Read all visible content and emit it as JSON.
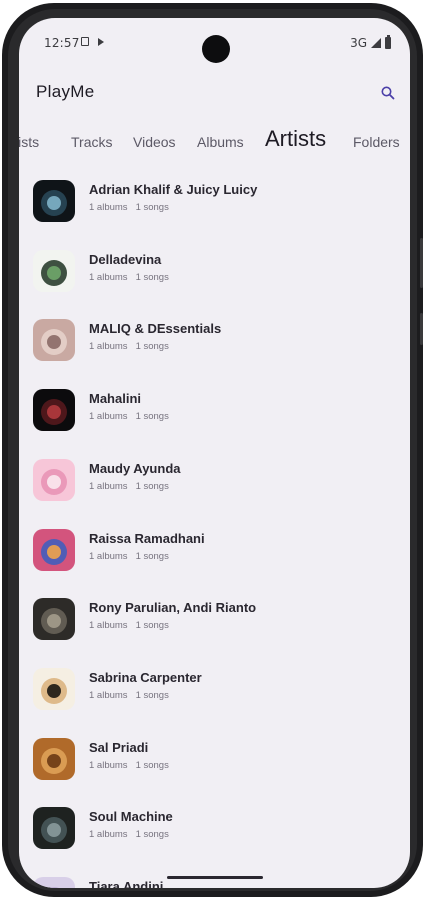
{
  "status_bar": {
    "time": "12:57",
    "network": "3G",
    "icons": [
      "photo-icon",
      "play-icon",
      "signal-icon",
      "battery-icon"
    ]
  },
  "app": {
    "title": "PlayMe",
    "search_icon": "search-icon"
  },
  "tabs": [
    {
      "label": "lists",
      "active": false
    },
    {
      "label": "Tracks",
      "active": false
    },
    {
      "label": "Videos",
      "active": false
    },
    {
      "label": "Albums",
      "active": false
    },
    {
      "label": "Artists",
      "active": true
    },
    {
      "label": "Folders",
      "active": false
    }
  ],
  "artists": [
    {
      "name": "Adrian Khalif & Juicy Luicy",
      "albums": "1 albums",
      "songs": "1 songs",
      "art_colors": [
        "#0f1418",
        "#2a4a5c",
        "#7fb3c8"
      ]
    },
    {
      "name": "Delladevina",
      "albums": "1 albums",
      "songs": "1 songs",
      "art_colors": [
        "#f2f4f0",
        "#1f3322",
        "#6fa66a"
      ]
    },
    {
      "name": "MALIQ & DEssentials",
      "albums": "1 albums",
      "songs": "1 songs",
      "art_colors": [
        "#c9a9a2",
        "#e8d4cc",
        "#8a6a66"
      ]
    },
    {
      "name": "Mahalini",
      "albums": "1 albums",
      "songs": "1 songs",
      "art_colors": [
        "#0c0b0d",
        "#5a1a1e",
        "#b23a3e"
      ]
    },
    {
      "name": "Maudy Ayunda",
      "albums": "1 albums",
      "songs": "1 songs",
      "art_colors": [
        "#f7c6d8",
        "#e890b4",
        "#fbe9ef"
      ]
    },
    {
      "name": "Raissa Ramadhani",
      "albums": "1 albums",
      "songs": "1 songs",
      "art_colors": [
        "#d3547d",
        "#3a5fbf",
        "#f0a34a"
      ]
    },
    {
      "name": "Rony Parulian, Andi Rianto",
      "albums": "1 albums",
      "songs": "1 songs",
      "art_colors": [
        "#2d2b28",
        "#6b655a",
        "#a49c8c"
      ]
    },
    {
      "name": "Sabrina Carpenter",
      "albums": "1 albums",
      "songs": "1 songs",
      "art_colors": [
        "#f5efe3",
        "#d9b07a",
        "#1a1712"
      ]
    },
    {
      "name": "Sal Priadi",
      "albums": "1 albums",
      "songs": "1 songs",
      "art_colors": [
        "#b06a2a",
        "#e2a55a",
        "#6a3a14"
      ]
    },
    {
      "name": "Soul Machine",
      "albums": "1 albums",
      "songs": "1 songs",
      "art_colors": [
        "#1e2220",
        "#4a5a5e",
        "#8a9a9c"
      ]
    },
    {
      "name": "Tiara Andini",
      "albums": "",
      "songs": "",
      "art_colors": [
        "#d8cfe8",
        "#b8a8d2",
        "#e9e4f1"
      ]
    }
  ]
}
